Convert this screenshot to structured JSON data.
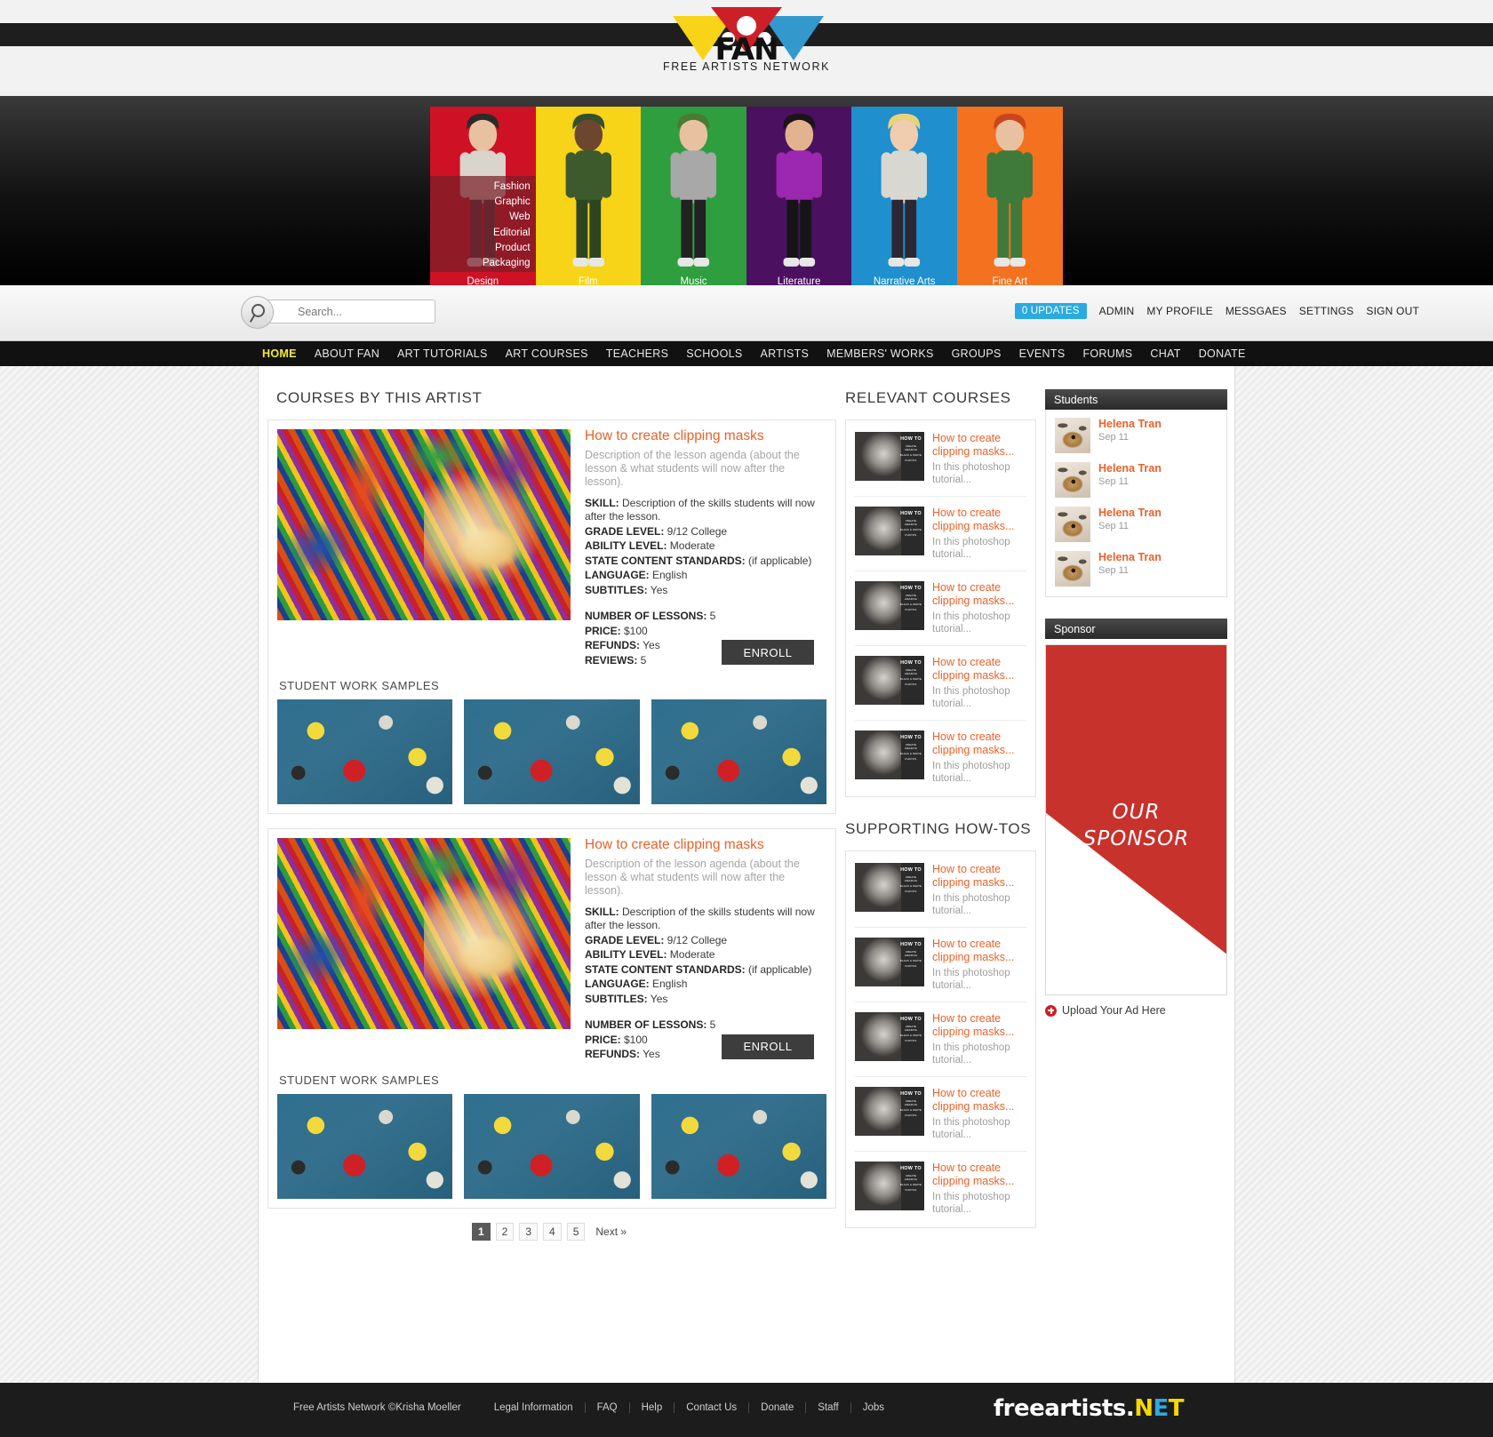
{
  "brand": {
    "name": "FAN",
    "tagline": "FREE ARTISTS NETWORK"
  },
  "hero": {
    "categories": [
      {
        "label": "Design",
        "color": "#cf1126"
      },
      {
        "label": "Film",
        "color": "#f7d417"
      },
      {
        "label": "Music",
        "color": "#2f9e3f"
      },
      {
        "label": "Literature",
        "color": "#4b1060"
      },
      {
        "label": "Narrative Arts",
        "color": "#1f8fce"
      },
      {
        "label": "Fine Art",
        "color": "#f4711f"
      }
    ],
    "dropdown": [
      "Fashion",
      "Graphic",
      "Web",
      "Editorial",
      "Product",
      "Packaging"
    ]
  },
  "search": {
    "placeholder": "Search...",
    "icon": "search-icon"
  },
  "toplinks": {
    "updates_badge": "0 UPDATES",
    "items": [
      "ADMIN",
      "MY PROFILE",
      "MESSGAES",
      "SETTINGS",
      "SIGN OUT"
    ]
  },
  "mainnav": {
    "active": "HOME",
    "items": [
      "HOME",
      "ABOUT FAN",
      "ART TUTORIALS",
      "ART COURSES",
      "TEACHERS",
      "SCHOOLS",
      "ARTISTS",
      "MEMBERS' WORKS",
      "GROUPS",
      "EVENTS",
      "FORUMS",
      "CHAT",
      "DONATE"
    ]
  },
  "main": {
    "heading": "COURSES BY THIS ARTIST",
    "samples_heading": "STUDENT WORK SAMPLES",
    "enroll_label": "ENROLL",
    "courses": [
      {
        "title": "How to create clipping masks",
        "description": "Description of the lesson agenda (about the lesson & what students will now after the lesson).",
        "specs": [
          {
            "label": "SKILL:",
            "value": "Description of the skills students will now after the lesson."
          },
          {
            "label": "GRADE LEVEL:",
            "value": "9/12 College"
          },
          {
            "label": "ABILITY LEVEL:",
            "value": "Moderate"
          },
          {
            "label": "STATE CONTENT STANDARDS:",
            "value": "(if applicable)"
          },
          {
            "label": "LANGUAGE:",
            "value": "English"
          },
          {
            "label": "SUBTITLES:",
            "value": "Yes"
          }
        ],
        "specs2": [
          {
            "label": "NUMBER OF LESSONS:",
            "value": "5"
          },
          {
            "label": "PRICE:",
            "value": "$100"
          },
          {
            "label": "REFUNDS:",
            "value": "Yes"
          },
          {
            "label": "REVIEWS:",
            "value": "5"
          }
        ]
      },
      {
        "title": "How to create clipping masks",
        "description": "Description of the lesson agenda (about the lesson & what students will now after the lesson).",
        "specs": [
          {
            "label": "SKILL:",
            "value": "Description of the skills students will now after the lesson."
          },
          {
            "label": "GRADE LEVEL:",
            "value": "9/12 College"
          },
          {
            "label": "ABILITY LEVEL:",
            "value": "Moderate"
          },
          {
            "label": "STATE CONTENT STANDARDS:",
            "value": "(if applicable)"
          },
          {
            "label": "LANGUAGE:",
            "value": "English"
          },
          {
            "label": "SUBTITLES:",
            "value": "Yes"
          }
        ],
        "specs2": [
          {
            "label": "NUMBER OF LESSONS:",
            "value": "5"
          },
          {
            "label": "PRICE:",
            "value": "$100"
          },
          {
            "label": "REFUNDS:",
            "value": "Yes"
          }
        ]
      }
    ],
    "pagination": {
      "pages": [
        "1",
        "2",
        "3",
        "4",
        "5"
      ],
      "current": "1",
      "next_label": "Next »"
    }
  },
  "midcol": {
    "relevant_heading": "RELEVANT COURSES",
    "howtos_heading": "SUPPORTING HOW-TOS",
    "thumb_text": {
      "l1": "HOW TO",
      "l2": "CREATE AMAZING",
      "l3": "BLACK & WHITE",
      "l4": "PHOTOS"
    },
    "relevant": [
      {
        "title": "How to create clipping masks...",
        "snippet": "In this photoshop tutorial..."
      },
      {
        "title": "How to create clipping masks...",
        "snippet": "In this photoshop tutorial..."
      },
      {
        "title": "How to create clipping masks...",
        "snippet": "In this photoshop tutorial..."
      },
      {
        "title": "How to create clipping masks...",
        "snippet": "In this photoshop tutorial..."
      },
      {
        "title": "How to create clipping masks...",
        "snippet": "In this photoshop tutorial..."
      }
    ],
    "howtos": [
      {
        "title": "How to create clipping masks...",
        "snippet": "In this photoshop tutorial..."
      },
      {
        "title": "How to create clipping masks...",
        "snippet": "In this photoshop tutorial..."
      },
      {
        "title": "How to create clipping masks...",
        "snippet": "In this photoshop tutorial..."
      },
      {
        "title": "How to create clipping masks...",
        "snippet": "In this photoshop tutorial..."
      },
      {
        "title": "How to create clipping masks...",
        "snippet": "In this photoshop tutorial..."
      }
    ]
  },
  "rightcol": {
    "students_heading": "Students",
    "students": [
      {
        "name": "Helena Tran",
        "date": "Sep 11"
      },
      {
        "name": "Helena Tran",
        "date": "Sep 11"
      },
      {
        "name": "Helena Tran",
        "date": "Sep 11"
      },
      {
        "name": "Helena Tran",
        "date": "Sep 11"
      }
    ],
    "sponsor_heading": "Sponsor",
    "sponsor_text_1": "OUR",
    "sponsor_text_2": "SPONSOR",
    "upload_label": "Upload Your Ad Here"
  },
  "footer": {
    "copyright": "Free Artists Network ©Krisha Moeller",
    "links": [
      "Legal Information",
      "FAQ",
      "Help",
      "Contact Us",
      "Donate",
      "Staff",
      "Jobs"
    ],
    "logo": {
      "word": "freeartists.",
      "n": "N",
      "e": "E",
      "t": "T"
    }
  }
}
